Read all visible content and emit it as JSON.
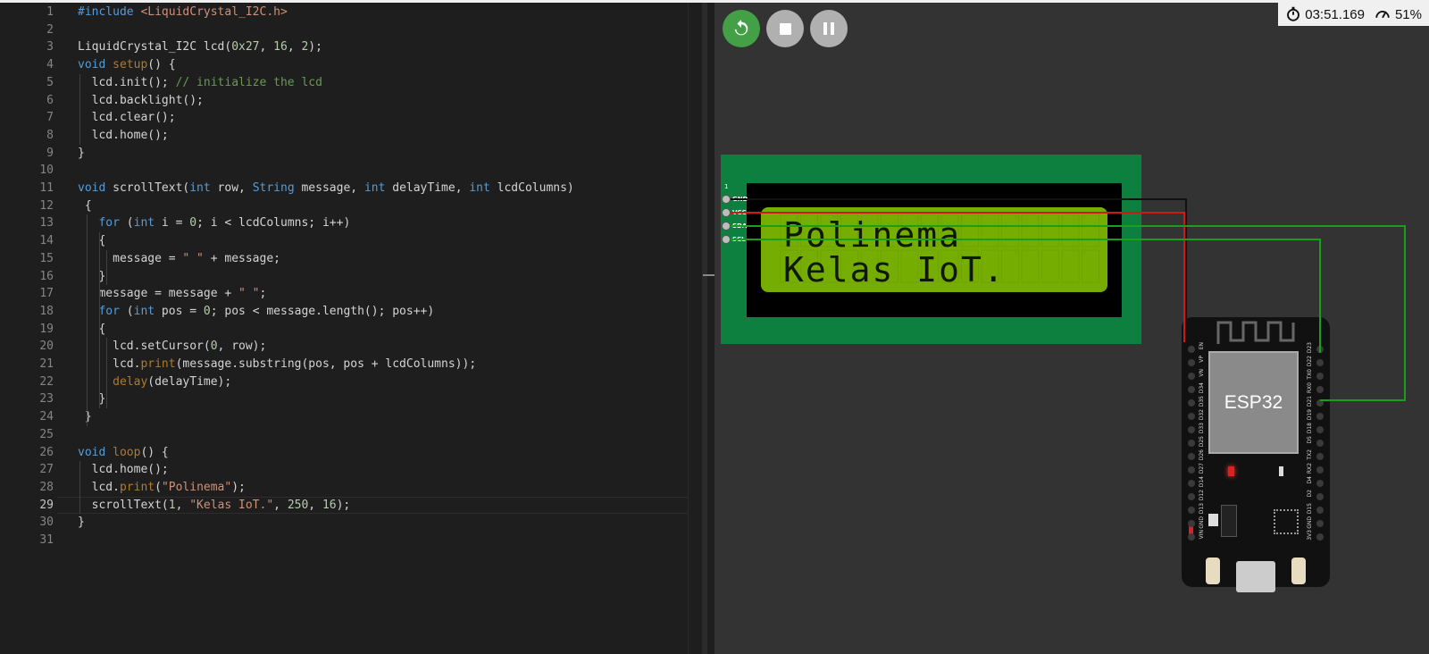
{
  "editor": {
    "lines": [
      {
        "n": "1",
        "html": "<span class=\"inc\">#include</span> <span class=\"str\">&lt;LiquidCrystal_I2C.h&gt;</span>"
      },
      {
        "n": "2",
        "html": ""
      },
      {
        "n": "3",
        "html": "LiquidCrystal_I2C lcd(<span class=\"num\">0x27</span>, <span class=\"num\">16</span>, <span class=\"num\">2</span>);"
      },
      {
        "n": "4",
        "html": "<span class=\"kw\">void</span> <span class=\"fnk\">setup</span>() {"
      },
      {
        "n": "5",
        "html": "  lcd.init(); <span class=\"cm\">// initialize the lcd</span>"
      },
      {
        "n": "6",
        "html": "  lcd.backlight();"
      },
      {
        "n": "7",
        "html": "  lcd.clear();"
      },
      {
        "n": "8",
        "html": "  lcd.home();"
      },
      {
        "n": "9",
        "html": "}"
      },
      {
        "n": "10",
        "html": ""
      },
      {
        "n": "11",
        "html": "<span class=\"kw\">void</span> scrollText(<span class=\"kw\">int</span> row, <span class=\"kw\">String</span> message, <span class=\"kw\">int</span> delayTime, <span class=\"kw\">int</span> lcdColumns)"
      },
      {
        "n": "12",
        "html": " {"
      },
      {
        "n": "13",
        "html": "   <span class=\"kw\">for</span> (<span class=\"kw\">int</span> i = <span class=\"num\">0</span>; i &lt; lcdColumns; i++)"
      },
      {
        "n": "14",
        "html": "   {"
      },
      {
        "n": "15",
        "html": "     message = <span class=\"str\">\" \"</span> + message;"
      },
      {
        "n": "16",
        "html": "   }"
      },
      {
        "n": "17",
        "html": "   message = message + <span class=\"str\">\" \"</span>;"
      },
      {
        "n": "18",
        "html": "   <span class=\"kw\">for</span> (<span class=\"kw\">int</span> pos = <span class=\"num\">0</span>; pos &lt; message.length(); pos++)"
      },
      {
        "n": "19",
        "html": "   {"
      },
      {
        "n": "20",
        "html": "     lcd.setCursor(<span class=\"num\">0</span>, row);"
      },
      {
        "n": "21",
        "html": "     lcd.<span class=\"fnk\">print</span>(message.substring(pos, pos + lcdColumns));"
      },
      {
        "n": "22",
        "html": "     <span class=\"fnk\">delay</span>(delayTime);"
      },
      {
        "n": "23",
        "html": "   }"
      },
      {
        "n": "24",
        "html": " }"
      },
      {
        "n": "25",
        "html": ""
      },
      {
        "n": "26",
        "html": "<span class=\"kw\">void</span> <span class=\"fnk\">loop</span>() {"
      },
      {
        "n": "27",
        "html": "  lcd.home();"
      },
      {
        "n": "28",
        "html": "  lcd.<span class=\"fnk\">print</span>(<span class=\"str\">\"Polinema\"</span>);"
      },
      {
        "n": "29",
        "html": "  scrollText(<span class=\"num\">1</span>, <span class=\"str\">\"Kelas IoT.\"</span>, <span class=\"num\">250</span>, <span class=\"num\">16</span>);"
      },
      {
        "n": "30",
        "html": "}"
      },
      {
        "n": "31",
        "html": ""
      }
    ],
    "current_line": "29"
  },
  "sim": {
    "controls": {
      "restart": "restart-icon",
      "stop": "stop-icon",
      "pause": "pause-icon",
      "restart_color": "#43a047",
      "button_color": "#b0b0b0"
    },
    "timer": "03:51.169",
    "speed": "51%",
    "lcd": {
      "line1": "Polinema",
      "line2": "Kelas IoT.",
      "pin1_label": "1",
      "pins": [
        "GND",
        "VCC",
        "SDA",
        "SCL"
      ]
    },
    "esp32": {
      "label": "ESP32",
      "left_pins": [
        "EN",
        "VP",
        "VN",
        "D34",
        "D35",
        "D32",
        "D33",
        "D25",
        "D26",
        "D27",
        "D14",
        "D12",
        "D13",
        "GND",
        "VIN"
      ],
      "right_pins": [
        "D23",
        "D22",
        "TX0",
        "RX0",
        "D21",
        "D19",
        "D18",
        "D5",
        "TX2",
        "RX2",
        "D4",
        "D2",
        "D15",
        "GND",
        "3V3"
      ]
    }
  }
}
